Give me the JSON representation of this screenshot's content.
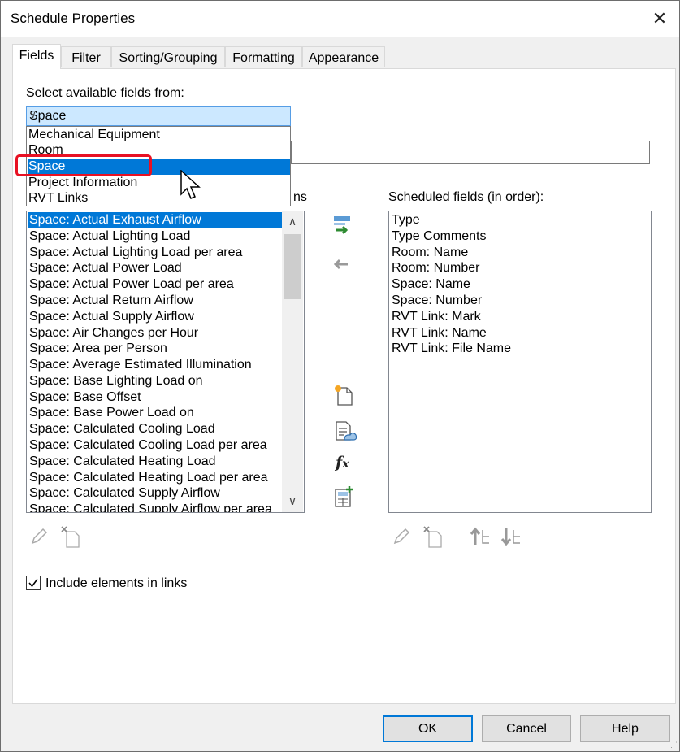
{
  "window": {
    "title": "Schedule Properties",
    "close_glyph": "✕"
  },
  "tabs": [
    {
      "label": "Fields"
    },
    {
      "label": "Filter"
    },
    {
      "label": "Sorting/Grouping"
    },
    {
      "label": "Formatting"
    },
    {
      "label": "Appearance"
    }
  ],
  "source": {
    "label": "Select available fields from:",
    "selected": "Space",
    "options": [
      "Mechanical Equipment",
      "Room",
      "Space",
      "Project Information",
      "RVT Links"
    ]
  },
  "available": {
    "label_partial": "ns",
    "items": [
      "Space: Actual Exhaust Airflow",
      "Space: Actual Lighting Load",
      "Space: Actual Lighting Load per area",
      "Space: Actual Power Load",
      "Space: Actual Power Load per area",
      "Space: Actual Return Airflow",
      "Space: Actual Supply Airflow",
      "Space: Air Changes per Hour",
      "Space: Area per Person",
      "Space: Average Estimated Illumination",
      "Space: Base Lighting Load on",
      "Space: Base Offset",
      "Space: Base Power Load on",
      "Space: Calculated Cooling Load",
      "Space: Calculated Cooling Load per area",
      "Space: Calculated Heating Load",
      "Space: Calculated Heating Load per area",
      "Space: Calculated Supply Airflow",
      "Space: Calculated Supply Airflow per area"
    ]
  },
  "scheduled": {
    "label": "Scheduled fields (in order):",
    "items": [
      "Type",
      "Type Comments",
      "Room: Name",
      "Room: Number",
      "Space: Name",
      "Space: Number",
      "RVT Link: Mark",
      "RVT Link: Name",
      "RVT Link: File Name"
    ]
  },
  "include_links": {
    "label": "Include elements in links",
    "checked": true
  },
  "buttons": {
    "ok": "OK",
    "cancel": "Cancel",
    "help": "Help"
  },
  "icons": {
    "add": "add-parameter-icon",
    "remove": "remove-parameter-icon",
    "new_param": "new-parameter-icon",
    "combine": "combine-parameters-icon",
    "formula": "calculated-value-icon",
    "edit": "edit-icon",
    "delete": "delete-icon",
    "move_up": "move-up-icon",
    "move_down": "move-down-icon"
  }
}
